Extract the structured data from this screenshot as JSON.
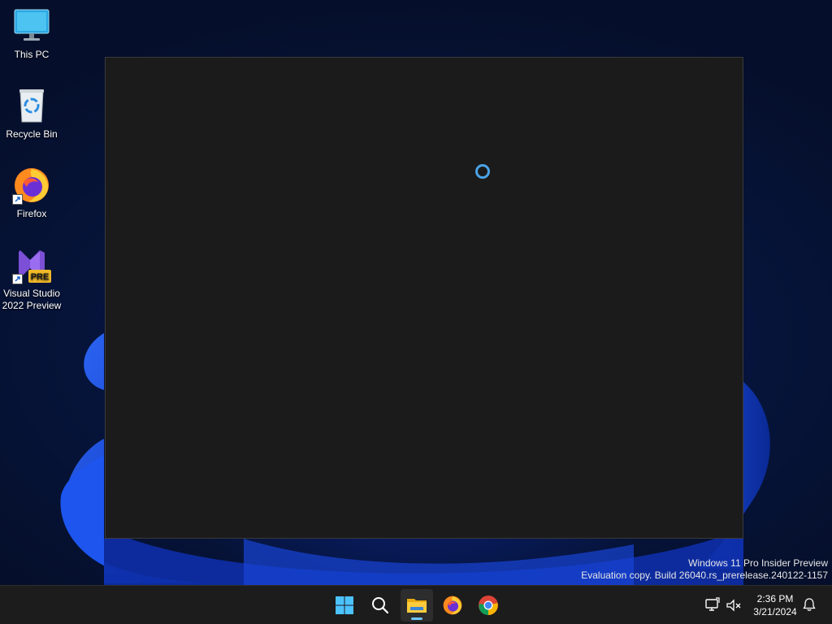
{
  "desktop": {
    "icons": [
      {
        "label": "This PC",
        "icon": "this-pc-icon"
      },
      {
        "label": "Recycle Bin",
        "icon": "recycle-bin-icon"
      },
      {
        "label": "Firefox",
        "icon": "firefox-icon"
      },
      {
        "label_line1": "Visual Studio",
        "label_line2": "2022 Preview",
        "badge": "PRE",
        "icon": "visual-studio-preview-icon"
      }
    ],
    "watermark": {
      "line1": "Windows 11 Pro Insider Preview",
      "line2": "Evaluation copy. Build 26040.rs_prerelease.240122-1157"
    }
  },
  "window": {
    "state": "loading",
    "spinner_color": "#4aa3e8",
    "background": "#1b1b1b"
  },
  "taskbar": {
    "apps": [
      {
        "name": "start",
        "icon": "windows-start-icon"
      },
      {
        "name": "search",
        "icon": "search-icon"
      },
      {
        "name": "file-explorer",
        "icon": "file-explorer-icon",
        "active": true
      },
      {
        "name": "firefox",
        "icon": "firefox-icon"
      },
      {
        "name": "chrome",
        "icon": "chrome-icon"
      }
    ],
    "tray": {
      "icons": [
        "network-icon",
        "volume-muted-icon"
      ],
      "time": "2:36 PM",
      "date": "3/21/2024",
      "notification_icon": "notification-bell-icon"
    }
  },
  "colors": {
    "accent": "#4aa3e8",
    "taskbar": "#1c1c1c",
    "desktop_bg": "#06122e"
  }
}
